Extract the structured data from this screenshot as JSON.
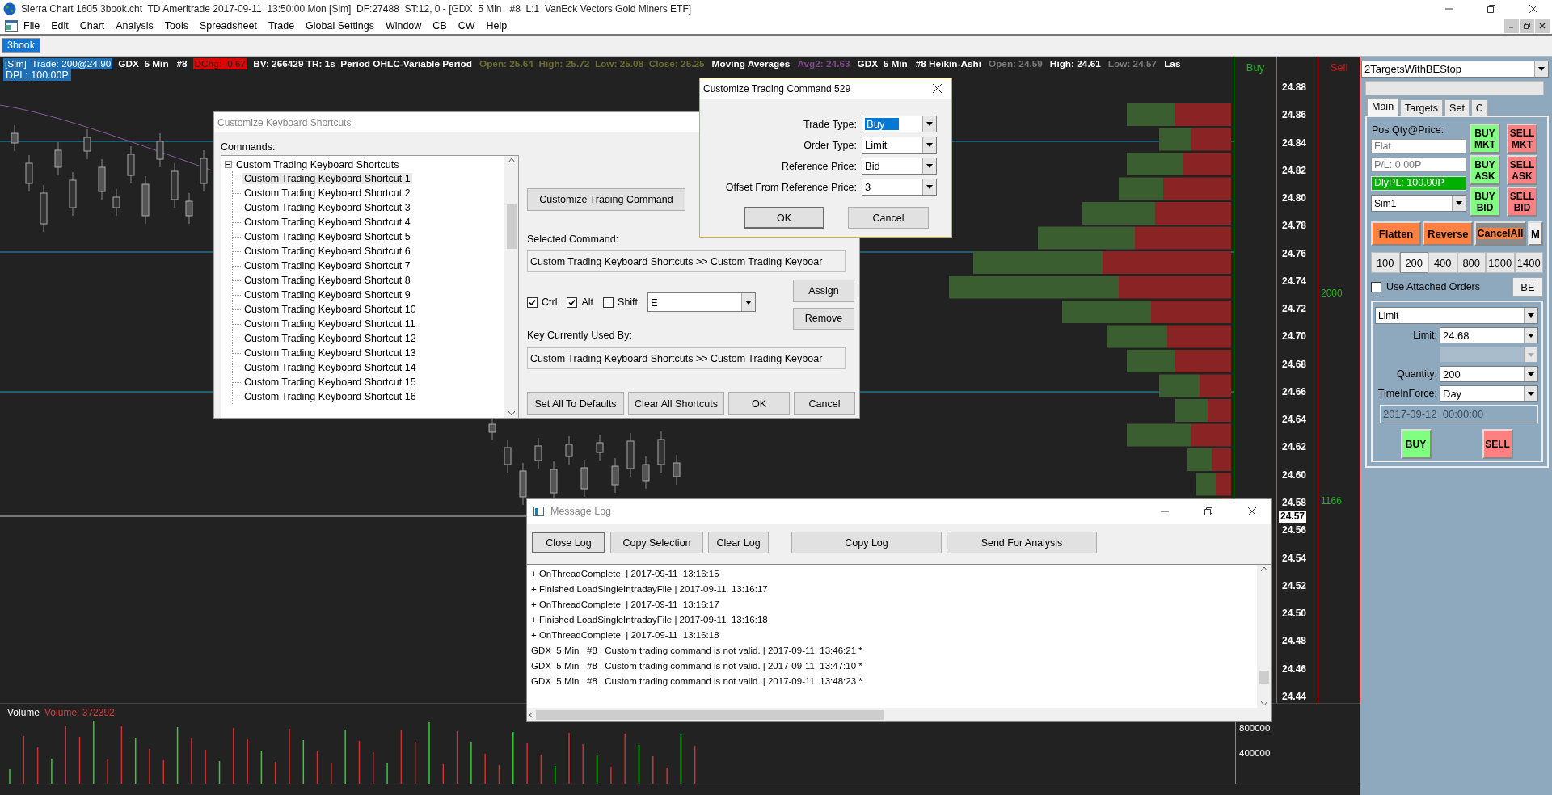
{
  "window": {
    "title": "Sierra Chart 1605 3book.cht  TD Ameritrade 2017-09-11  13:50:00 Mon [Sim]  DF:27488  ST:12, 0 - [GDX  5 Min   #8  L:1  VanEck Vectors Gold Miners ETF]"
  },
  "menu": [
    "File",
    "Edit",
    "Chart",
    "Analysis",
    "Tools",
    "Spreadsheet",
    "Trade",
    "Global Settings",
    "Window",
    "CB",
    "CW",
    "Help"
  ],
  "chart_tabs": [
    {
      "label": "3book",
      "selected": true
    }
  ],
  "chart": {
    "info_line": [
      {
        "text": "[Sim]  Trade: 200@24.90",
        "kind": "account"
      },
      {
        "text": "GDX  5 Min   #8",
        "kind": "plain"
      },
      {
        "text": "DChg: -0.67",
        "kind": "change"
      },
      {
        "text": "BV: 266429 TR: 1s  Period OHLC-Variable Period",
        "kind": "plain"
      },
      {
        "text": "Open: 25.64  High: 25.72  Low: 25.08  Close: 25.25",
        "kind": "ohlc"
      },
      {
        "text": "Moving Averages",
        "kind": "plain"
      },
      {
        "text": "Avg2: 24.63",
        "kind": "study"
      },
      {
        "text": "GDX  5 Min   #8 Heikin-Ashi",
        "kind": "plain"
      },
      {
        "text": "Open: 24.59",
        "kind": "dim"
      },
      {
        "text": "High: 24.61",
        "kind": "plain"
      },
      {
        "text": "Low: 24.57",
        "kind": "dim"
      },
      {
        "text": "Las",
        "kind": "plain"
      }
    ],
    "dpl": "DPL: 100.00P",
    "buy_heading": "Buy",
    "sell_heading": "Sell",
    "price_labels": [
      "24.88",
      "24.86",
      "24.84",
      "24.82",
      "24.80",
      "24.78",
      "24.76",
      "24.74",
      "24.72",
      "24.70",
      "24.68",
      "24.66",
      "24.64",
      "24.62",
      "24.60",
      "24.58",
      "24.56",
      "24.54",
      "24.52",
      "24.50",
      "24.48",
      "24.46",
      "24.44"
    ],
    "current_price": "24.57",
    "sell_column_labels": [
      "2000",
      "1166"
    ],
    "volume": {
      "title": "Volume",
      "reading": "Volume: 372392",
      "axis_labels": [
        "800000",
        "400000"
      ]
    }
  },
  "trade_panel": {
    "strategy": "2TargetsWithBEStop",
    "tabs": [
      {
        "label": "Main",
        "selected": true
      },
      {
        "label": "Targets",
        "selected": false
      },
      {
        "label": "Set",
        "selected": false
      },
      {
        "label": "C",
        "selected": false
      }
    ],
    "position_label": "Pos Qty@Price:",
    "position_placeholder": "Flat",
    "pl_placeholder": "P/L: 0.00P",
    "daily_pl": "DlyPL: 100.00P",
    "account": "Sim1",
    "order_buttons": [
      {
        "label": "BUY MKT",
        "kind": "buy"
      },
      {
        "label": "SELL MKT",
        "kind": "sell"
      },
      {
        "label": "BUY ASK",
        "kind": "buy"
      },
      {
        "label": "SELL ASK",
        "kind": "sell"
      },
      {
        "label": "BUY BID",
        "kind": "buy"
      },
      {
        "label": "SELL BID",
        "kind": "sell"
      }
    ],
    "actions": [
      {
        "label": "Flatten",
        "kind": "warn"
      },
      {
        "label": "Reverse",
        "kind": "warn"
      },
      {
        "label": "CancelAll",
        "kind": "cancel"
      },
      {
        "label": "M",
        "kind": "plain"
      }
    ],
    "quantities": [
      {
        "label": "100",
        "selected": false
      },
      {
        "label": "200",
        "selected": true
      },
      {
        "label": "400",
        "selected": false
      },
      {
        "label": "800",
        "selected": false
      },
      {
        "label": "1000",
        "selected": false
      },
      {
        "label": "1400",
        "selected": false
      }
    ],
    "attached_orders": {
      "label": "Use Attached Orders",
      "checked": false
    },
    "be_button": "BE",
    "order_type": "Limit",
    "limit_label": "Limit:",
    "limit_value": "24.68",
    "quantity_label": "Quantity:",
    "quantity_value": "200",
    "tif_label": "TimeInForce:",
    "tif_value": "Day",
    "expiry": "2017-09-12  00:00:00",
    "buy_button": "BUY",
    "sell_button": "SELL"
  },
  "shortcuts_dialog": {
    "title": "Customize Keyboard Shortcuts",
    "commands_label": "Commands:",
    "tree": {
      "label": "Custom Trading Keyboard Shortcuts",
      "expanded": true,
      "children": [
        {
          "label": "Custom Trading Keyboard Shortcut 1",
          "selected": true
        },
        {
          "label": "Custom Trading Keyboard Shortcut 2",
          "selected": false
        },
        {
          "label": "Custom Trading Keyboard Shortcut 3",
          "selected": false
        },
        {
          "label": "Custom Trading Keyboard Shortcut 4",
          "selected": false
        },
        {
          "label": "Custom Trading Keyboard Shortcut 5",
          "selected": false
        },
        {
          "label": "Custom Trading Keyboard Shortcut 6",
          "selected": false
        },
        {
          "label": "Custom Trading Keyboard Shortcut 7",
          "selected": false
        },
        {
          "label": "Custom Trading Keyboard Shortcut 8",
          "selected": false
        },
        {
          "label": "Custom Trading Keyboard Shortcut 9",
          "selected": false
        },
        {
          "label": "Custom Trading Keyboard Shortcut 10",
          "selected": false
        },
        {
          "label": "Custom Trading Keyboard Shortcut 11",
          "selected": false
        },
        {
          "label": "Custom Trading Keyboard Shortcut 12",
          "selected": false
        },
        {
          "label": "Custom Trading Keyboard Shortcut 13",
          "selected": false
        },
        {
          "label": "Custom Trading Keyboard Shortcut 14",
          "selected": false
        },
        {
          "label": "Custom Trading Keyboard Shortcut 15",
          "selected": false
        },
        {
          "label": "Custom Trading Keyboard Shortcut 16",
          "selected": false
        }
      ]
    },
    "customize_button": "Customize Trading Command",
    "selected_command_label": "Selected Command:",
    "selected_command": "Custom Trading Keyboard Shortcuts >> Custom Trading Keyboar",
    "modifiers": [
      {
        "label": "Ctrl",
        "checked": true
      },
      {
        "label": "Alt",
        "checked": true
      },
      {
        "label": "Shift",
        "checked": false
      }
    ],
    "key": "E",
    "assign_button": "Assign",
    "remove_button": "Remove",
    "used_by_label": "Key Currently Used By:",
    "used_by": "Custom Trading Keyboard Shortcuts >> Custom Trading Keyboar",
    "buttons": [
      "Set All To Defaults",
      "Clear All Shortcuts",
      "OK",
      "Cancel"
    ]
  },
  "trading_command_dialog": {
    "title": "Customize Trading Command 529",
    "fields": [
      {
        "label": "Trade Type:",
        "value": "Buy",
        "focused": true
      },
      {
        "label": "Order Type:",
        "value": "Limit",
        "focused": false
      },
      {
        "label": "Reference Price:",
        "value": "Bid",
        "focused": false
      },
      {
        "label": "Offset From Reference Price:",
        "value": "3",
        "focused": false
      }
    ],
    "buttons": [
      {
        "label": "OK",
        "default": true
      },
      {
        "label": "Cancel",
        "default": false
      }
    ]
  },
  "message_log": {
    "title": "Message Log",
    "buttons": [
      {
        "label": "Close Log",
        "default": true
      },
      {
        "label": "Copy Selection",
        "default": false
      },
      {
        "label": "Clear Log",
        "default": false
      },
      {
        "label": "Copy Log",
        "default": false
      },
      {
        "label": "Send For Analysis",
        "default": false
      }
    ],
    "lines": [
      "+ OnThreadComplete. | 2017-09-11  13:16:15",
      "+ Finished LoadSingleIntradayFile | 2017-09-11  13:16:17",
      "+ OnThreadComplete. | 2017-09-11  13:16:17",
      "+ Finished LoadSingleIntradayFile | 2017-09-11  13:16:18",
      "+ OnThreadComplete. | 2017-09-11  13:16:18",
      "GDX  5 Min   #8 | Custom trading command is not valid. | 2017-09-11  13:46:21 *",
      "GDX  5 Min   #8 | Custom trading command is not valid. | 2017-09-11  13:47:10 *",
      "GDX  5 Min   #8 | Custom trading command is not valid. | 2017-09-11  13:48:23 *"
    ]
  }
}
